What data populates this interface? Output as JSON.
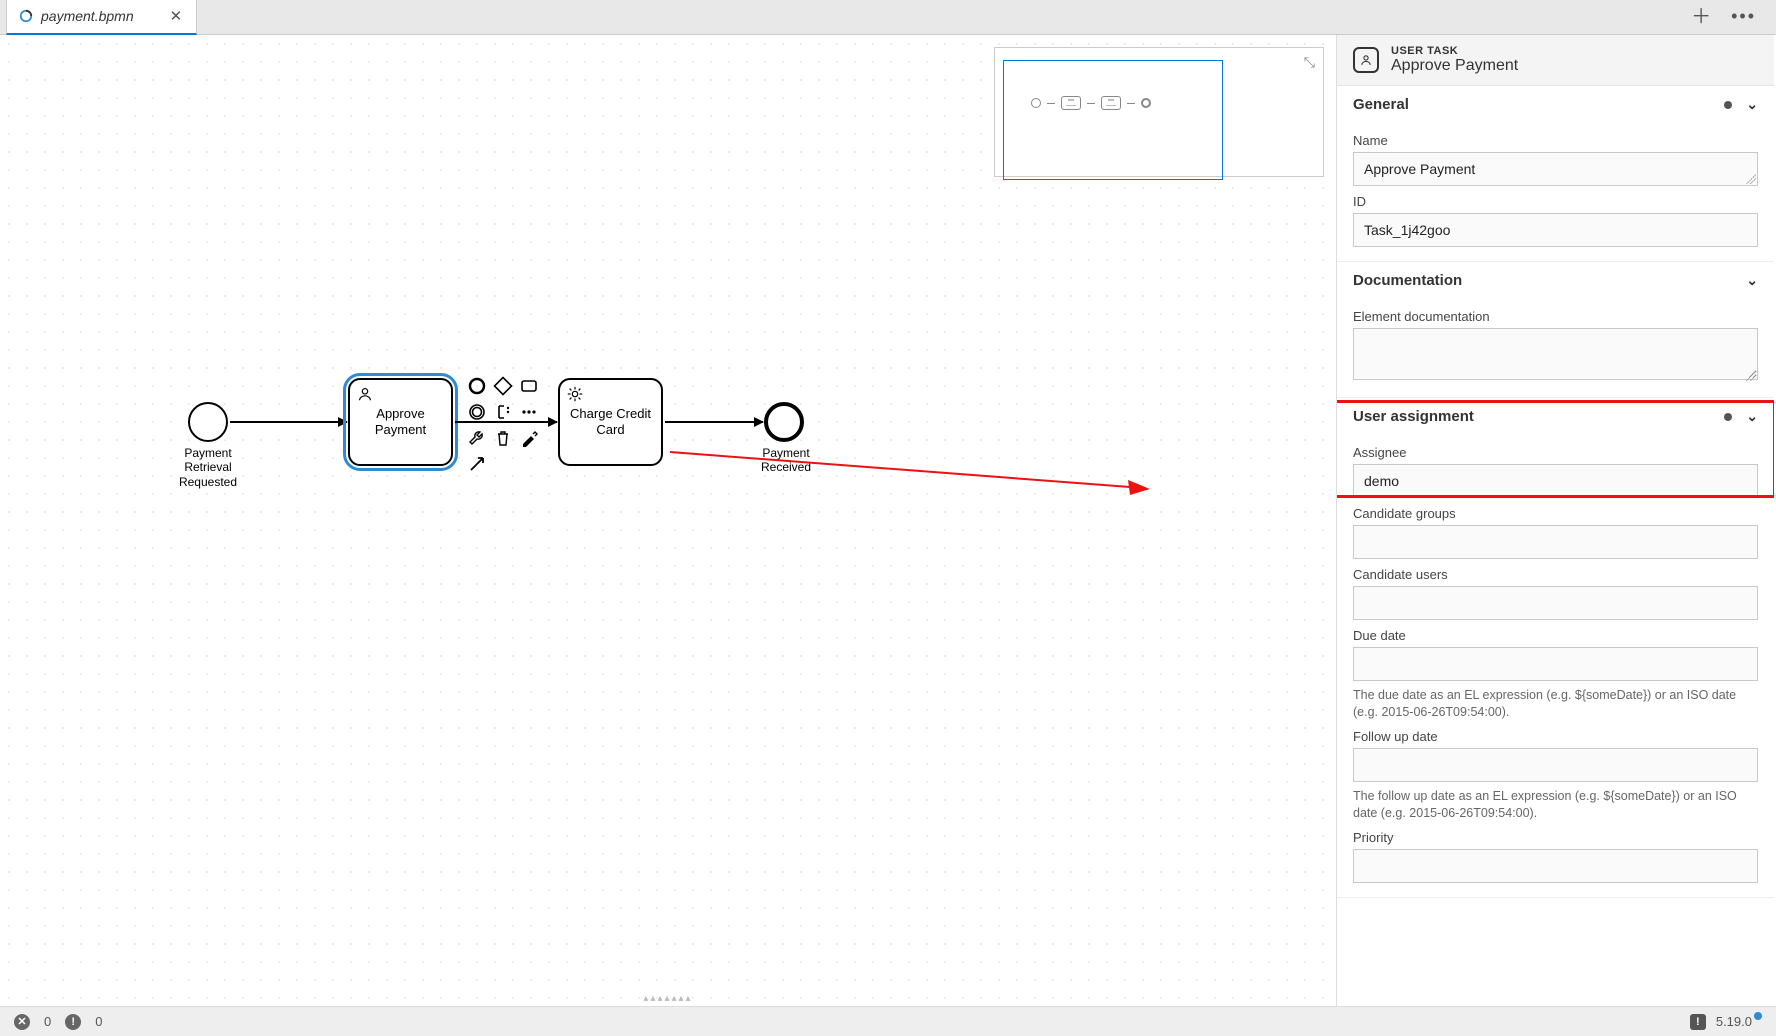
{
  "tab": {
    "filename": "payment.bpmn"
  },
  "canvas": {
    "start_label": "Payment\nRetrieval\nRequested",
    "task_approve": "Approve\nPayment",
    "task_charge": "Charge Credit\nCard",
    "end_label": "Payment\nReceived"
  },
  "panel": {
    "header_kind": "USER TASK",
    "header_name": "Approve Payment",
    "sections": {
      "general": {
        "title": "General",
        "name_label": "Name",
        "name_value": "Approve Payment",
        "id_label": "ID",
        "id_value": "Task_1j42goo"
      },
      "documentation": {
        "title": "Documentation",
        "doc_label": "Element documentation",
        "doc_value": ""
      },
      "user_assignment": {
        "title": "User assignment",
        "assignee_label": "Assignee",
        "assignee_value": "demo",
        "cand_groups_label": "Candidate groups",
        "cand_groups_value": "",
        "cand_users_label": "Candidate users",
        "cand_users_value": "",
        "due_label": "Due date",
        "due_value": "",
        "due_hint": "The due date as an EL expression (e.g. ${someDate}) or an ISO date (e.g. 2015-06-26T09:54:00).",
        "follow_label": "Follow up date",
        "follow_value": "",
        "follow_hint": "The follow up date as an EL expression (e.g. ${someDate}) or an ISO date (e.g. 2015-06-26T09:54:00).",
        "priority_label": "Priority"
      }
    }
  },
  "status": {
    "errors": "0",
    "warnings": "0",
    "version": "5.19.0"
  }
}
